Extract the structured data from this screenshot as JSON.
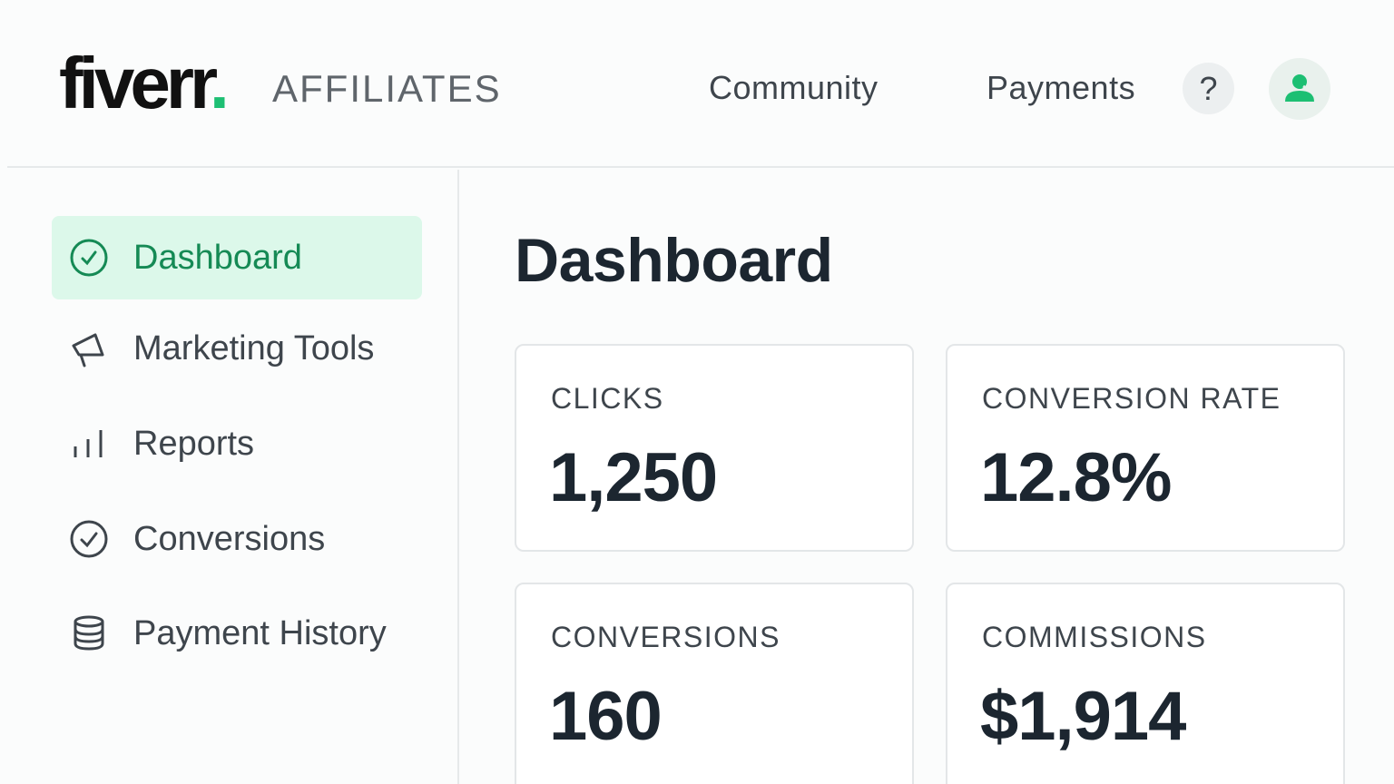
{
  "header": {
    "logo_text": "fiverr",
    "logo_dot": ".",
    "subtitle": "AFFILIATES",
    "nav": {
      "community": "Community",
      "payments": "Payments"
    },
    "help_label": "?",
    "icons": {
      "help": "question-icon",
      "avatar": "user-icon"
    }
  },
  "sidebar": {
    "items": [
      {
        "label": "Dashboard",
        "icon": "check-circle-icon",
        "active": true
      },
      {
        "label": "Marketing Tools",
        "icon": "megaphone-icon",
        "active": false
      },
      {
        "label": "Reports",
        "icon": "bar-chart-icon",
        "active": false
      },
      {
        "label": "Conversions",
        "icon": "check-circle-icon",
        "active": false
      },
      {
        "label": "Payment History",
        "icon": "coins-stack-icon",
        "active": false
      }
    ]
  },
  "main": {
    "title": "Dashboard",
    "stats": [
      {
        "label": "CLICKS",
        "value": "1,250"
      },
      {
        "label": "CONVERSION RATE",
        "value": "12.8%"
      },
      {
        "label": "CONVERSIONS",
        "value": "160"
      },
      {
        "label": "COMMISSIONS",
        "value": "$1,914"
      }
    ]
  },
  "colors": {
    "brand_green": "#1dbf73",
    "active_bg": "#dcf8ea",
    "active_text": "#158a55",
    "text_dark": "#1c2630",
    "text_muted": "#3e454c"
  }
}
